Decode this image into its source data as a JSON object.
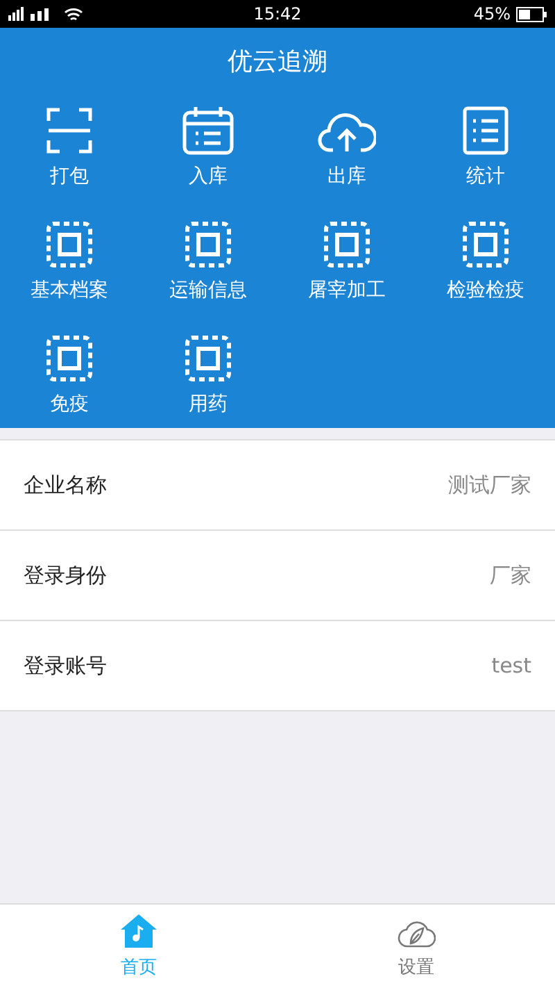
{
  "status_bar": {
    "time": "15:42",
    "battery": "45%"
  },
  "header": {
    "title": "优云追溯"
  },
  "menu": [
    {
      "kind": "scan",
      "label": "打包"
    },
    {
      "kind": "calendar",
      "label": "入库"
    },
    {
      "kind": "cloud",
      "label": "出库"
    },
    {
      "kind": "list",
      "label": "统计"
    },
    {
      "kind": "chip",
      "label": "基本档案"
    },
    {
      "kind": "chip",
      "label": "运输信息"
    },
    {
      "kind": "chip",
      "label": "屠宰加工"
    },
    {
      "kind": "chip",
      "label": "检验检疫"
    },
    {
      "kind": "chip",
      "label": "免疫"
    },
    {
      "kind": "chip",
      "label": "用药"
    }
  ],
  "info": [
    {
      "label": "企业名称",
      "value": "测试厂家"
    },
    {
      "label": "登录身份",
      "value": "厂家"
    },
    {
      "label": "登录账号",
      "value": "test"
    }
  ],
  "tabs": [
    {
      "kind": "home",
      "label": "首页",
      "selected": true
    },
    {
      "kind": "leaf",
      "label": "设置",
      "selected": false
    }
  ]
}
